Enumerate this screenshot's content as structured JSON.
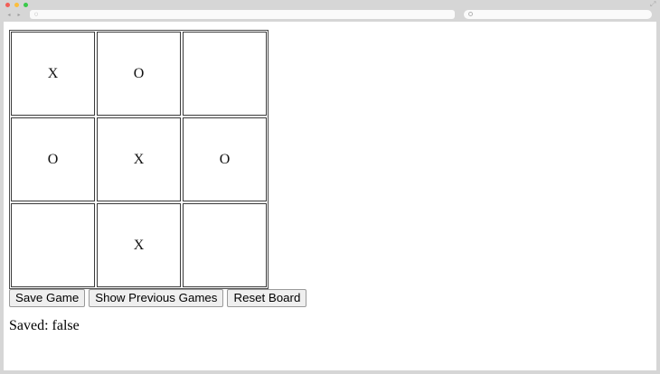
{
  "window": {
    "controls": [
      {
        "name": "close",
        "color": "#f25f58"
      },
      {
        "name": "minimize",
        "color": "#fbbe3c"
      },
      {
        "name": "maximize",
        "color": "#39c94a"
      }
    ]
  },
  "toolbar": {
    "back_icon": "◂",
    "forward_icon": "▸",
    "expand_icon": "⤢"
  },
  "board": {
    "cells": [
      "X",
      "O",
      "",
      "O",
      "X",
      "O",
      "",
      "X",
      ""
    ]
  },
  "buttons": {
    "save": "Save Game",
    "show_previous": "Show Previous Games",
    "reset": "Reset Board"
  },
  "status": {
    "saved": "Saved: false"
  }
}
